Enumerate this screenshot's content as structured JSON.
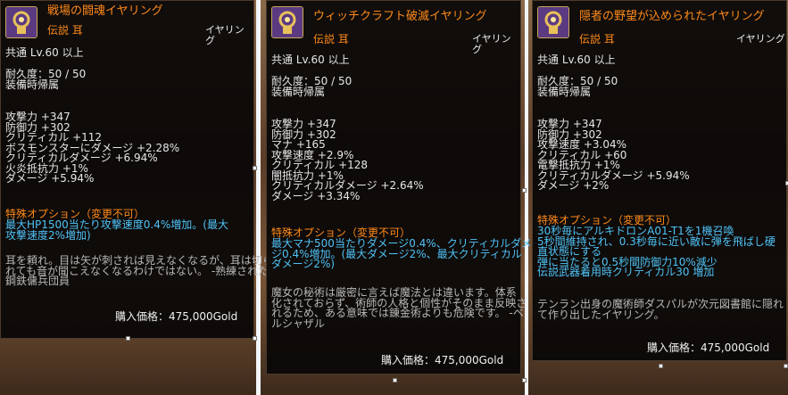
{
  "common": {
    "rarity": "伝説 耳",
    "slot": "イヤリング",
    "level_req": "共通 Lv.60 以上",
    "durability": "耐久度：50 / 50",
    "binding": "装備時帰属",
    "special_header": "特殊オプション（変更不可）",
    "price": "購入価格：475,000Gold"
  },
  "tooltips": [
    {
      "name": "戦場の闘魂イヤリング",
      "stats": [
        "攻撃力 +347",
        "防御力 +302",
        "クリティカル +112",
        "ボスモンスターにダメージ +2.28%",
        "クリティカルダメージ +6.94%",
        "火炎抵抗力 +1%",
        "ダメージ +5.94%"
      ],
      "special": [
        "最大HP1500当たり攻撃速度0.4%増加。(最大",
        "攻撃速度2%増加)"
      ],
      "lore": [
        "耳を頼れ。目は矢が刺されば見えなくなるが、耳は切ら",
        "れても音が聞こえなくなるわけではない。 -熟練された",
        "鋼鉄傭兵団員"
      ]
    },
    {
      "name": "ウィッチクラフト破滅イヤリング",
      "stats": [
        "攻撃力 +347",
        "防御力 +302",
        "マナ +165",
        "攻撃速度 +2.9%",
        "クリティカル +128",
        "闇抵抗力 +1%",
        "クリティカルダメージ +2.64%",
        "ダメージ +3.34%"
      ],
      "special": [
        "最大マナ500当たりダメージ0.4%、クリティカルダメー",
        "ジ0.4%増加。(最大ダメージ2%、最大クリティカル",
        "ダメージ2%)"
      ],
      "lore": [
        "魔女の秘術は厳密に言えば魔法とは違います。体系",
        "化されておらず、術師の人格と個性がそのまま反映さ",
        "れるため、ある意味では錬金術よりも危険です。 -ベ",
        "ルシャザル"
      ]
    },
    {
      "name": "隠者の野望が込められたイヤリング",
      "stats": [
        "攻撃力 +347",
        "防御力 +302",
        "攻撃速度 +3.04%",
        "クリティカル +60",
        "電撃抵抗力 +1%",
        "クリティカルダメージ +5.94%",
        "ダメージ +2%"
      ],
      "special": [
        "30秒毎にアルキドロンA01-T1を1機召喚",
        "5秒間維持され、0.3秒毎に近い敵に弾を飛ばし硬",
        "直状態にする",
        "弾に当たると0.5秒間防御力10%減少",
        "伝説武器着用時クリティカル30 増加"
      ],
      "lore": [
        "テンラン出身の魔術師ダスパルが次元図書館に隠れ",
        "て作り出したイヤリング。"
      ]
    }
  ]
}
